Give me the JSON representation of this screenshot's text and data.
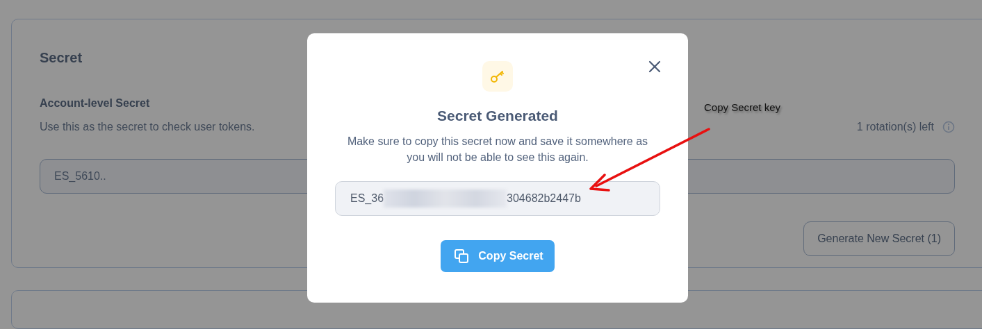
{
  "card": {
    "title": "Secret",
    "section_title": "Account-level Secret",
    "description": "Use this as the secret to check user tokens.",
    "rotations": "1 rotation(s) left",
    "secret_value": "ES_5610..",
    "button": "Generate New Secret (1)"
  },
  "dialog": {
    "title": "Secret Generated",
    "message": "Make sure to copy this secret now and save it somewhere as you will not be able to see this again.",
    "secret": {
      "prefix": "ES_36",
      "suffix": "304682b2447b",
      "redacted": true
    },
    "button": "Copy Secret"
  },
  "annotation": {
    "text": "Copy Secret key"
  }
}
